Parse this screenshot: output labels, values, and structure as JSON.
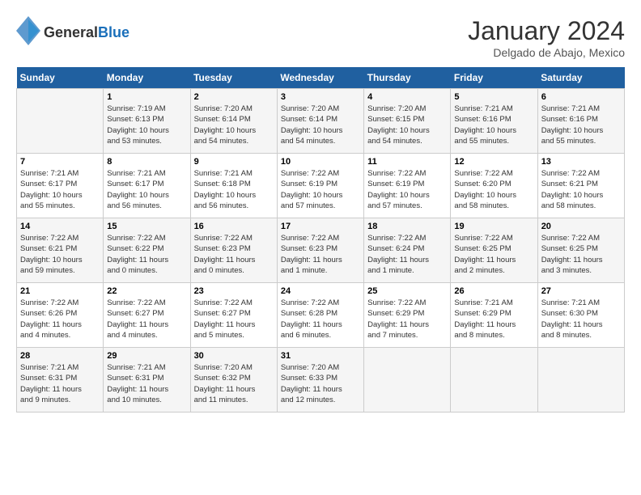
{
  "logo": {
    "text_general": "General",
    "text_blue": "Blue"
  },
  "header": {
    "month": "January 2024",
    "location": "Delgado de Abajo, Mexico"
  },
  "days_of_week": [
    "Sunday",
    "Monday",
    "Tuesday",
    "Wednesday",
    "Thursday",
    "Friday",
    "Saturday"
  ],
  "weeks": [
    [
      {
        "day": "",
        "info": ""
      },
      {
        "day": "1",
        "info": "Sunrise: 7:19 AM\nSunset: 6:13 PM\nDaylight: 10 hours\nand 53 minutes."
      },
      {
        "day": "2",
        "info": "Sunrise: 7:20 AM\nSunset: 6:14 PM\nDaylight: 10 hours\nand 54 minutes."
      },
      {
        "day": "3",
        "info": "Sunrise: 7:20 AM\nSunset: 6:14 PM\nDaylight: 10 hours\nand 54 minutes."
      },
      {
        "day": "4",
        "info": "Sunrise: 7:20 AM\nSunset: 6:15 PM\nDaylight: 10 hours\nand 54 minutes."
      },
      {
        "day": "5",
        "info": "Sunrise: 7:21 AM\nSunset: 6:16 PM\nDaylight: 10 hours\nand 55 minutes."
      },
      {
        "day": "6",
        "info": "Sunrise: 7:21 AM\nSunset: 6:16 PM\nDaylight: 10 hours\nand 55 minutes."
      }
    ],
    [
      {
        "day": "7",
        "info": "Sunrise: 7:21 AM\nSunset: 6:17 PM\nDaylight: 10 hours\nand 55 minutes."
      },
      {
        "day": "8",
        "info": "Sunrise: 7:21 AM\nSunset: 6:17 PM\nDaylight: 10 hours\nand 56 minutes."
      },
      {
        "day": "9",
        "info": "Sunrise: 7:21 AM\nSunset: 6:18 PM\nDaylight: 10 hours\nand 56 minutes."
      },
      {
        "day": "10",
        "info": "Sunrise: 7:22 AM\nSunset: 6:19 PM\nDaylight: 10 hours\nand 57 minutes."
      },
      {
        "day": "11",
        "info": "Sunrise: 7:22 AM\nSunset: 6:19 PM\nDaylight: 10 hours\nand 57 minutes."
      },
      {
        "day": "12",
        "info": "Sunrise: 7:22 AM\nSunset: 6:20 PM\nDaylight: 10 hours\nand 58 minutes."
      },
      {
        "day": "13",
        "info": "Sunrise: 7:22 AM\nSunset: 6:21 PM\nDaylight: 10 hours\nand 58 minutes."
      }
    ],
    [
      {
        "day": "14",
        "info": "Sunrise: 7:22 AM\nSunset: 6:21 PM\nDaylight: 10 hours\nand 59 minutes."
      },
      {
        "day": "15",
        "info": "Sunrise: 7:22 AM\nSunset: 6:22 PM\nDaylight: 11 hours\nand 0 minutes."
      },
      {
        "day": "16",
        "info": "Sunrise: 7:22 AM\nSunset: 6:23 PM\nDaylight: 11 hours\nand 0 minutes."
      },
      {
        "day": "17",
        "info": "Sunrise: 7:22 AM\nSunset: 6:23 PM\nDaylight: 11 hours\nand 1 minute."
      },
      {
        "day": "18",
        "info": "Sunrise: 7:22 AM\nSunset: 6:24 PM\nDaylight: 11 hours\nand 1 minute."
      },
      {
        "day": "19",
        "info": "Sunrise: 7:22 AM\nSunset: 6:25 PM\nDaylight: 11 hours\nand 2 minutes."
      },
      {
        "day": "20",
        "info": "Sunrise: 7:22 AM\nSunset: 6:25 PM\nDaylight: 11 hours\nand 3 minutes."
      }
    ],
    [
      {
        "day": "21",
        "info": "Sunrise: 7:22 AM\nSunset: 6:26 PM\nDaylight: 11 hours\nand 4 minutes."
      },
      {
        "day": "22",
        "info": "Sunrise: 7:22 AM\nSunset: 6:27 PM\nDaylight: 11 hours\nand 4 minutes."
      },
      {
        "day": "23",
        "info": "Sunrise: 7:22 AM\nSunset: 6:27 PM\nDaylight: 11 hours\nand 5 minutes."
      },
      {
        "day": "24",
        "info": "Sunrise: 7:22 AM\nSunset: 6:28 PM\nDaylight: 11 hours\nand 6 minutes."
      },
      {
        "day": "25",
        "info": "Sunrise: 7:22 AM\nSunset: 6:29 PM\nDaylight: 11 hours\nand 7 minutes."
      },
      {
        "day": "26",
        "info": "Sunrise: 7:21 AM\nSunset: 6:29 PM\nDaylight: 11 hours\nand 8 minutes."
      },
      {
        "day": "27",
        "info": "Sunrise: 7:21 AM\nSunset: 6:30 PM\nDaylight: 11 hours\nand 8 minutes."
      }
    ],
    [
      {
        "day": "28",
        "info": "Sunrise: 7:21 AM\nSunset: 6:31 PM\nDaylight: 11 hours\nand 9 minutes."
      },
      {
        "day": "29",
        "info": "Sunrise: 7:21 AM\nSunset: 6:31 PM\nDaylight: 11 hours\nand 10 minutes."
      },
      {
        "day": "30",
        "info": "Sunrise: 7:20 AM\nSunset: 6:32 PM\nDaylight: 11 hours\nand 11 minutes."
      },
      {
        "day": "31",
        "info": "Sunrise: 7:20 AM\nSunset: 6:33 PM\nDaylight: 11 hours\nand 12 minutes."
      },
      {
        "day": "",
        "info": ""
      },
      {
        "day": "",
        "info": ""
      },
      {
        "day": "",
        "info": ""
      }
    ]
  ]
}
